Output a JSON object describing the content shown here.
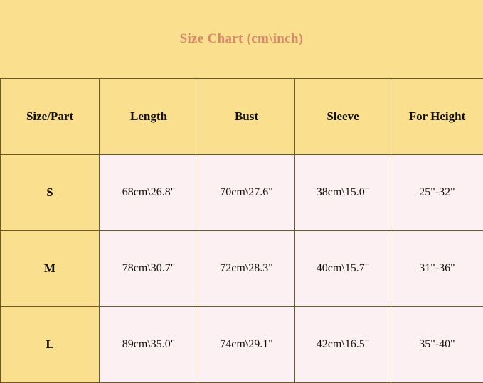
{
  "title": "Size Chart (cm\\inch)",
  "colors": {
    "background_yellow": "#fae08e",
    "cell_pink": "#fdf0f2",
    "border": "#6b5a26",
    "title_text": "#d9886a",
    "body_text": "#120f06"
  },
  "table": {
    "headers": [
      "Size/Part",
      "Length",
      "Bust",
      "Sleeve",
      "For Height"
    ],
    "rows": [
      {
        "size": "S",
        "length": "68cm\\26.8\"",
        "bust": "70cm\\27.6\"",
        "sleeve": "38cm\\15.0\"",
        "for_height": "25\"-32\""
      },
      {
        "size": "M",
        "length": "78cm\\30.7\"",
        "bust": "72cm\\28.3\"",
        "sleeve": "40cm\\15.7\"",
        "for_height": "31\"-36\""
      },
      {
        "size": "L",
        "length": "89cm\\35.0\"",
        "bust": "74cm\\29.1\"",
        "sleeve": "42cm\\16.5\"",
        "for_height": "35\"-40\""
      }
    ]
  }
}
